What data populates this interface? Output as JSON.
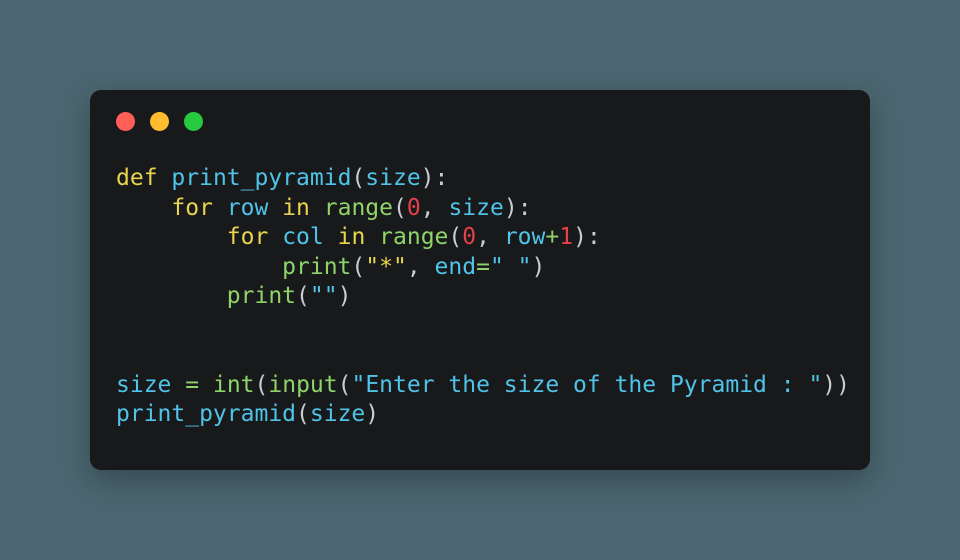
{
  "window": {
    "background_color": "#4b6670",
    "card_background": "#18191b",
    "traffic_lights": [
      {
        "name": "close",
        "color": "#ff5f56"
      },
      {
        "name": "minimize",
        "color": "#ffbd2e"
      },
      {
        "name": "maximize",
        "color": "#27c93f"
      }
    ]
  },
  "editor": {
    "language": "python",
    "theme_colors": {
      "keyword": "#e8d44d",
      "function": "#8fd46a",
      "identifier": "#4fc3e8",
      "number": "#e4414a",
      "string_yellow": "#e8d44d",
      "string_blue": "#4fc3e8",
      "operator": "#8fd46a",
      "punctuation": "#c8cdd2"
    },
    "lines": [
      "def print_pyramid(size):",
      "    for row in range(0, size):",
      "        for col in range(0, row+1):",
      "            print(\"*\", end=\" \")",
      "        print(\"\")",
      "",
      "",
      "size = int(input(\"Enter the size of the Pyramid : \"))",
      "print_pyramid(size)"
    ],
    "full_source": "def print_pyramid(size):\n    for row in range(0, size):\n        for col in range(0, row+1):\n            print(\"*\", end=\" \")\n        print(\"\")\n\n\nsize = int(input(\"Enter the size of the Pyramid : \"))\nprint_pyramid(size)",
    "tokens": {
      "line1": {
        "kw_def": "def",
        "name": "print_pyramid",
        "open": "(",
        "arg": "size",
        "close": ")",
        "colon": ":"
      },
      "line2": {
        "indent": "    ",
        "kw_for": "for",
        "var": "row",
        "kw_in": "in",
        "fn": "range",
        "open": "(",
        "num": "0",
        "comma": ", ",
        "arg": "size",
        "close": ")",
        "colon": ":"
      },
      "line3": {
        "indent": "        ",
        "kw_for": "for",
        "var": "col",
        "kw_in": "in",
        "fn": "range",
        "open": "(",
        "num": "0",
        "comma": ", ",
        "arg": "row",
        "plus": "+",
        "num2": "1",
        "close": ")",
        "colon": ":"
      },
      "line4": {
        "indent": "            ",
        "fn": "print",
        "open": "(",
        "str": "\"*\"",
        "comma": ", ",
        "kwarg": "end",
        "eq": "=",
        "str2": "\" \"",
        "close": ")"
      },
      "line5": {
        "indent": "        ",
        "fn": "print",
        "open": "(",
        "str": "\"\"",
        "close": ")"
      },
      "line8": {
        "var": "size",
        "eq": "=",
        "fn_int": "int",
        "open": "(",
        "fn_input": "input",
        "open2": "(",
        "str": "\"Enter the size of the Pyramid : \"",
        "close2": ")",
        "close": ")"
      },
      "line9": {
        "name": "print_pyramid",
        "open": "(",
        "arg": "size",
        "close": ")"
      }
    }
  }
}
